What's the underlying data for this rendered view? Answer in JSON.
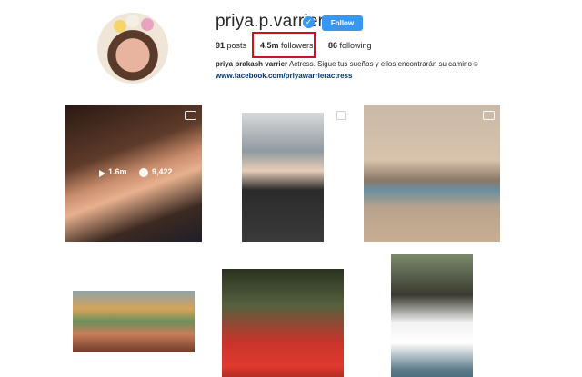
{
  "profile": {
    "username": "priya.p.varrier",
    "verified_glyph": "✓",
    "follow_label": "Follow",
    "posts_count": "91",
    "posts_label": "posts",
    "followers_count": "4.5m",
    "followers_label": "followers",
    "following_count": "86",
    "following_label": "following",
    "bio_name": "priya prakash varrier",
    "bio_text": "Actress. Sigue tus sueños y ellos encontrarán su camino☺",
    "bio_link": "www.facebook.com/priyawarrieractress"
  },
  "posts": [
    {
      "type": "video",
      "views": "1.6m",
      "comments": "9,422",
      "icon": "video-icon"
    },
    {
      "type": "multi",
      "icon": "multiple-photos-icon"
    },
    {
      "type": "video",
      "icon": "video-icon"
    },
    {
      "type": "photo"
    },
    {
      "type": "photo"
    },
    {
      "type": "photo"
    }
  ],
  "colors": {
    "accent": "#3897f0",
    "highlight": "#d0121e",
    "link": "#003569"
  }
}
